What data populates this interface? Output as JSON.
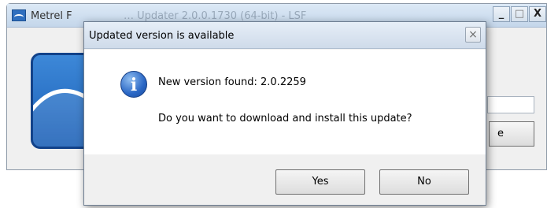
{
  "background_window": {
    "title": "Metrel F",
    "title_obscured": "…  Updater 2.0.0.1730 (64-bit) - LSF",
    "controls": {
      "minimize": "_",
      "maximize": "□",
      "close": "X"
    },
    "button_fragment": "e",
    "logo_icon": "metrel-wave-logo"
  },
  "dialog": {
    "title": "Updated version is available",
    "close_glyph": "×",
    "icon": "info-icon",
    "message_line1": "New version found: 2.0.2259",
    "message_line2": "Do you want to download and install this update?",
    "buttons": {
      "yes": "Yes",
      "no": "No"
    }
  },
  "colors": {
    "titlebar": "#cfdbea",
    "logo_blue": "#1b5fb6",
    "info_blue": "#2a67c5"
  }
}
